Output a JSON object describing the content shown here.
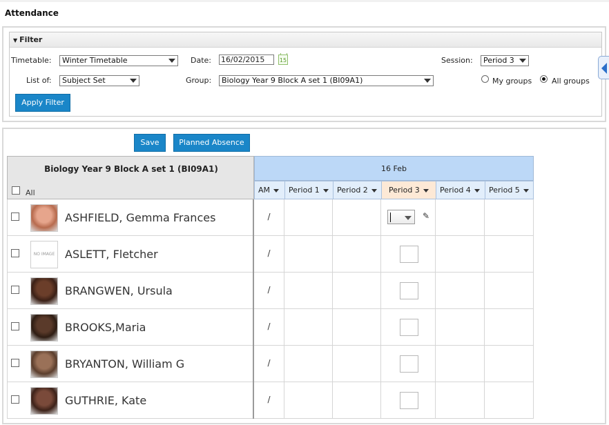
{
  "page_title": "Attendance",
  "filter": {
    "header": "Filter",
    "timetable_label": "Timetable:",
    "timetable_value": "Winter Timetable",
    "date_label": "Date:",
    "date_value": "16/02/2015",
    "calendar_icon": "calendar-icon",
    "calendar_day": "15",
    "session_label": "Session:",
    "session_value": "Period 3",
    "listof_label": "List of:",
    "listof_value": "Subject Set",
    "group_label": "Group:",
    "group_value": "Biology Year 9 Block A set 1 (BI09A1)",
    "my_groups_label": "My groups",
    "all_groups_label": "All groups",
    "selected_scope": "All groups",
    "apply_label": "Apply Filter"
  },
  "actions": {
    "save_label": "Save",
    "planned_absence_label": "Planned Absence"
  },
  "grid": {
    "group_title": "Biology Year 9 Block A set 1 (BI09A1)",
    "all_label": "All",
    "date_header": "16 Feb",
    "columns": [
      "AM",
      "Period 1",
      "Period 2",
      "Period 3",
      "Period 4",
      "Period 5"
    ],
    "active_column": "Period 3",
    "no_image_text": "NO IMAGE",
    "students": [
      {
        "name": "ASHFIELD, Gemma Frances",
        "am": "/",
        "photo": true
      },
      {
        "name": "ASLETT, Fletcher",
        "am": "/",
        "photo": false
      },
      {
        "name": "BRANGWEN, Ursula",
        "am": "/",
        "photo": true
      },
      {
        "name": "BROOKS,Maria",
        "am": "/",
        "photo": true
      },
      {
        "name": "BRYANTON, William G",
        "am": "/",
        "photo": true
      },
      {
        "name": "GUTHRIE, Kate",
        "am": "/",
        "photo": true
      }
    ]
  },
  "colors": {
    "accent": "#1a86c8",
    "date_header_bg": "#bcd8f7",
    "active_column_bg": "#fde9d6"
  }
}
